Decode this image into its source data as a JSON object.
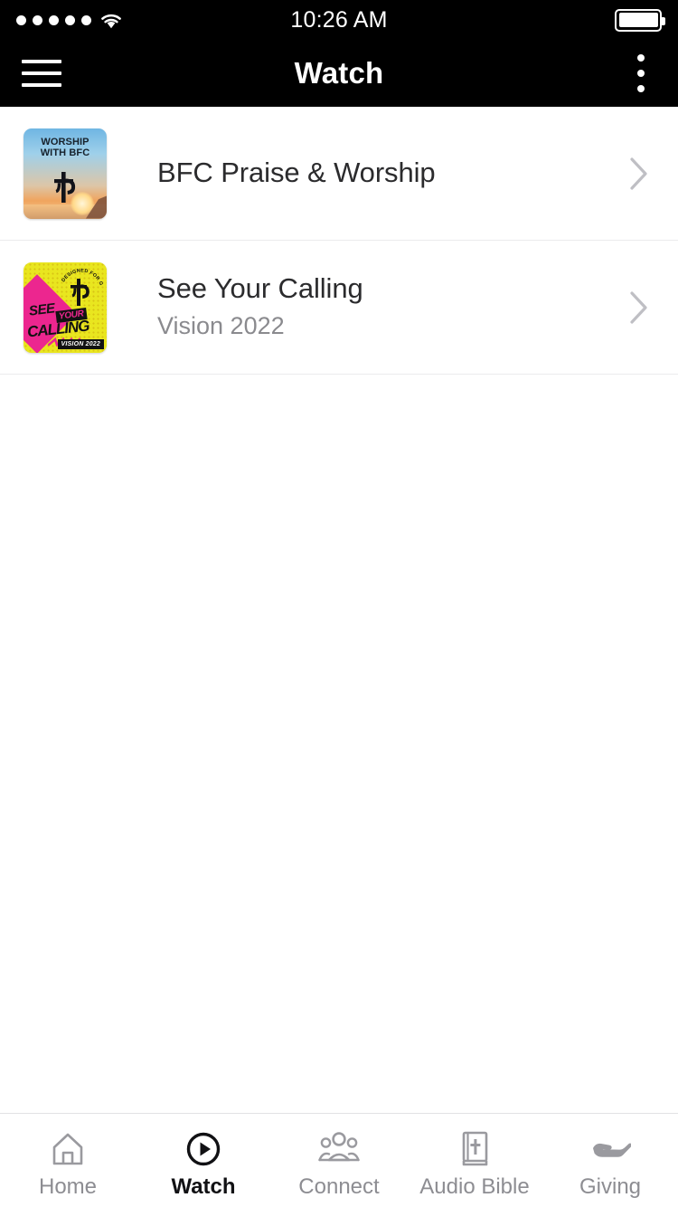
{
  "status_bar": {
    "signal_dots": 5,
    "wifi_icon": "wifi-icon",
    "time": "10:26 AM",
    "battery_icon": "battery-full-icon",
    "background": "#000000",
    "foreground": "#ffffff"
  },
  "nav_bar": {
    "menu_icon": "hamburger-menu-icon",
    "title": "Watch",
    "overflow_icon": "kebab-menu-icon",
    "background": "#000000",
    "foreground": "#ffffff"
  },
  "list": {
    "items": [
      {
        "title": "BFC Praise & Worship",
        "subtitle": "",
        "chevron": "chevron-right-icon",
        "thumbnail": {
          "kind": "worship",
          "line1": "WORSHIP",
          "line2": "WITH BFC",
          "logo": "jc-cross-monogram",
          "colors": {
            "sky": "#6fb6e3",
            "sunset": "#f0a45e",
            "text": "#17212b"
          }
        }
      },
      {
        "title": "See Your Calling",
        "subtitle": "Vision 2022",
        "chevron": "chevron-right-icon",
        "thumbnail": {
          "kind": "calling",
          "word1": "SEE",
          "word2": "YOUR",
          "word3": "CALLING",
          "badge": "VISION 2022",
          "logo": "jc-cross-monogram",
          "colors": {
            "yellow": "#e9e61f",
            "magenta": "#ec268f",
            "ink": "#121212"
          }
        }
      }
    ]
  },
  "tab_bar": {
    "active_index": 1,
    "active_color": "#111114",
    "inactive_color": "#8d8d92",
    "tabs": [
      {
        "label": "Home",
        "icon": "home-icon"
      },
      {
        "label": "Watch",
        "icon": "play-circle-icon"
      },
      {
        "label": "Connect",
        "icon": "people-group-icon"
      },
      {
        "label": "Audio Bible",
        "icon": "bible-book-icon"
      },
      {
        "label": "Giving",
        "icon": "open-hand-icon"
      }
    ]
  }
}
